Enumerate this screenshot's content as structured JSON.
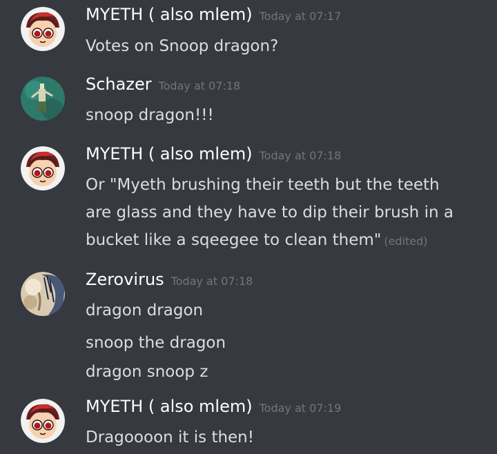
{
  "messages": [
    {
      "username": "MYETH ( also mlem)",
      "timestamp": "Today at 07:17",
      "avatar": "myeth-avatar",
      "lines": [
        "Votes on Snoop dragon?"
      ]
    },
    {
      "username": "Schazer",
      "timestamp": "Today at 07:18",
      "avatar": "schazer-avatar",
      "lines": [
        "snoop dragon!!!"
      ]
    },
    {
      "username": "MYETH ( also mlem)",
      "timestamp": "Today at 07:18",
      "avatar": "myeth-avatar",
      "lines": [
        "Or \"Myeth brushing their teeth but the teeth",
        "are glass and they have to dip their brush in a",
        "bucket like a sqeegee to clean them\""
      ],
      "edited_label": "(edited)"
    },
    {
      "username": "Zerovirus",
      "timestamp": "Today at 07:18",
      "avatar": "zerovirus-avatar",
      "lines": [
        "dragon dragon",
        "snoop the dragon",
        "dragon snoop z"
      ]
    },
    {
      "username": "MYETH ( also mlem)",
      "timestamp": "Today at 07:19",
      "avatar": "myeth-avatar",
      "lines": [
        "Dragoooon it is then!"
      ]
    }
  ],
  "colors": {
    "background": "#36393f",
    "username": "#ffffff",
    "message_text": "#dcddde",
    "timestamp": "#72767d"
  }
}
